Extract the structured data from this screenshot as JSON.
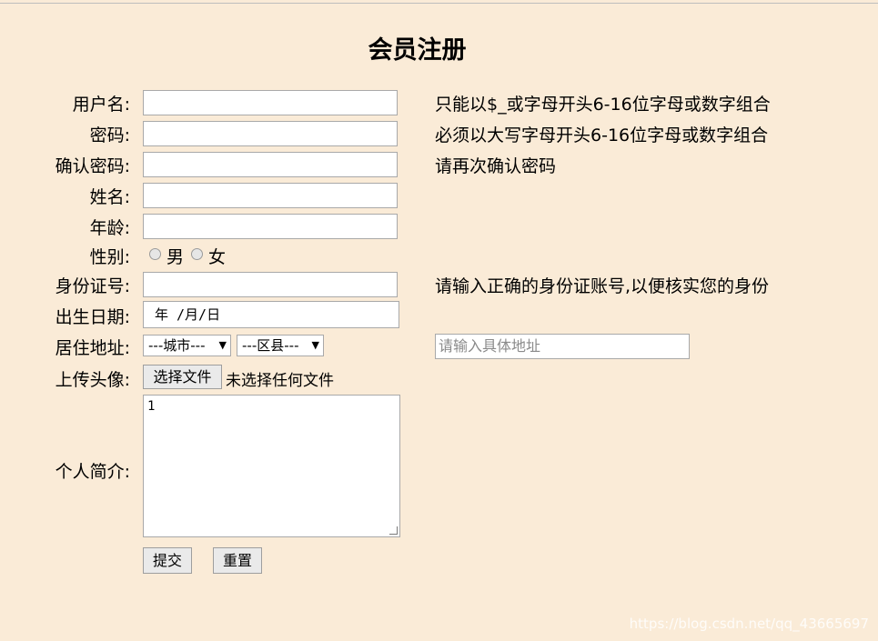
{
  "title": "会员注册",
  "form": {
    "username_label": "用户名:",
    "username_value": "",
    "username_hint": "只能以$_或字母开头6-16位字母或数字组合",
    "password_label": "密码:",
    "password_value": "",
    "password_hint": "必须以大写字母开头6-16位字母或数字组合",
    "confirm_label": "确认密码:",
    "confirm_value": "",
    "confirm_hint": "请再次确认密码",
    "name_label": "姓名:",
    "name_value": "",
    "age_label": "年龄:",
    "age_value": "",
    "gender_label": "性别:",
    "gender_male": "男",
    "gender_female": "女",
    "id_label": "身份证号:",
    "id_value": "",
    "id_hint": "请输入正确的身份证账号,以便核实您的身份",
    "birth_label": "出生日期:",
    "birth_value": "年 /月/日",
    "address_label": "居住地址:",
    "city_select": "---城市---",
    "district_select": "---区县---",
    "address_placeholder": "请输入具体地址",
    "avatar_label": "上传头像:",
    "choose_file": "选择文件",
    "no_file": "未选择任何文件",
    "intro_label": "个人简介:",
    "intro_value": "1",
    "submit": "提交",
    "reset": "重置"
  },
  "watermark": "https://blog.csdn.net/qq_43665697",
  "colors": {
    "background": "#faebd7"
  }
}
